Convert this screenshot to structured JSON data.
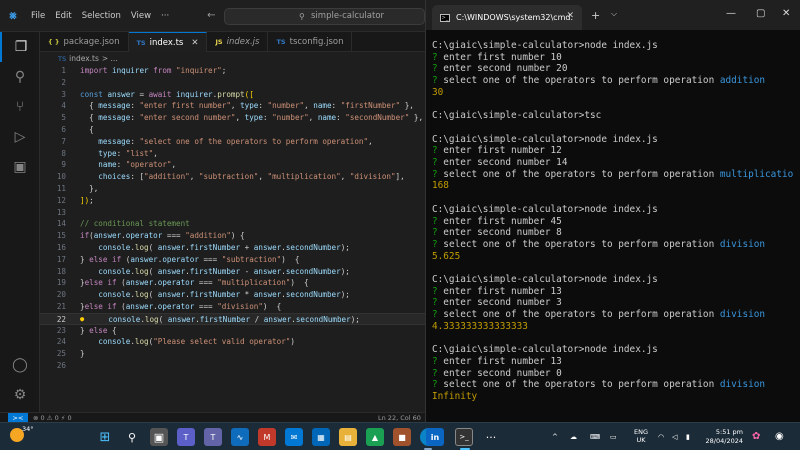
{
  "vscode": {
    "menu": [
      "File",
      "Edit",
      "Selection",
      "View",
      "···"
    ],
    "search_text": "simple-calculator",
    "tabs": [
      {
        "icon": "{ }",
        "type": "json",
        "label": "package.json"
      },
      {
        "icon": "TS",
        "type": "ts",
        "label": "index.ts"
      },
      {
        "icon": "JS",
        "type": "js",
        "label": "index.js"
      },
      {
        "icon": "TS",
        "type": "ts",
        "label": "tsconfig.json"
      }
    ],
    "breadcrumb": {
      "icon": "TS",
      "label": "index.ts",
      "more": "> ..."
    },
    "lines": [
      {
        "n": "1",
        "tokens": [
          [
            "kw",
            "import "
          ],
          [
            "vr",
            "inquirer "
          ],
          [
            "kw",
            "from "
          ],
          [
            "st",
            "\"inquirer\""
          ],
          [
            "",
            "; "
          ]
        ]
      },
      {
        "n": "2",
        "tokens": []
      },
      {
        "n": "3",
        "tokens": [
          [
            "bl",
            "const "
          ],
          [
            "vr",
            "answer"
          ],
          [
            "",
            " = "
          ],
          [
            "kw",
            "await "
          ],
          [
            "vr",
            "inquirer"
          ],
          [
            "",
            "."
          ],
          [
            "fn",
            "prompt"
          ],
          [
            "pu",
            "(["
          ]
        ]
      },
      {
        "n": "4",
        "tokens": [
          [
            "",
            "  { "
          ],
          [
            "vr",
            "message"
          ],
          [
            "",
            ": "
          ],
          [
            "st",
            "\"enter first number\""
          ],
          [
            "",
            ", "
          ],
          [
            "vr",
            "type"
          ],
          [
            "",
            ": "
          ],
          [
            "st",
            "\"number\""
          ],
          [
            "",
            ", "
          ],
          [
            "vr",
            "name"
          ],
          [
            "",
            ": "
          ],
          [
            "st",
            "\"firstNumber\""
          ],
          [
            "",
            " },"
          ]
        ]
      },
      {
        "n": "5",
        "tokens": [
          [
            "",
            "  { "
          ],
          [
            "vr",
            "message"
          ],
          [
            "",
            ": "
          ],
          [
            "st",
            "\"enter second number\""
          ],
          [
            "",
            ", "
          ],
          [
            "vr",
            "type"
          ],
          [
            "",
            ": "
          ],
          [
            "st",
            "\"number\""
          ],
          [
            "",
            ", "
          ],
          [
            "vr",
            "name"
          ],
          [
            "",
            ": "
          ],
          [
            "st",
            "\"secondNumber\""
          ],
          [
            "",
            " },"
          ]
        ]
      },
      {
        "n": "6",
        "tokens": [
          [
            "",
            "  {"
          ]
        ]
      },
      {
        "n": "7",
        "tokens": [
          [
            "",
            "    "
          ],
          [
            "vr",
            "message"
          ],
          [
            "",
            ": "
          ],
          [
            "st",
            "\"select one of the operators to perform operation\""
          ],
          [
            "",
            ","
          ]
        ]
      },
      {
        "n": "8",
        "tokens": [
          [
            "",
            "    "
          ],
          [
            "vr",
            "type"
          ],
          [
            "",
            ": "
          ],
          [
            "st",
            "\"list\""
          ],
          [
            "",
            ","
          ]
        ]
      },
      {
        "n": "9",
        "tokens": [
          [
            "",
            "    "
          ],
          [
            "vr",
            "name"
          ],
          [
            "",
            ": "
          ],
          [
            "st",
            "\"operator\""
          ],
          [
            "",
            ","
          ]
        ]
      },
      {
        "n": "10",
        "tokens": [
          [
            "",
            "    "
          ],
          [
            "vr",
            "choices"
          ],
          [
            "",
            ": ["
          ],
          [
            "st",
            "\"addition\""
          ],
          [
            "",
            ", "
          ],
          [
            "st",
            "\"subtraction\""
          ],
          [
            "",
            ", "
          ],
          [
            "st",
            "\"multiplication\""
          ],
          [
            "",
            ", "
          ],
          [
            "st",
            "\"division\""
          ],
          [
            "",
            "],"
          ]
        ]
      },
      {
        "n": "11",
        "tokens": [
          [
            "",
            "  },"
          ]
        ]
      },
      {
        "n": "12",
        "tokens": [
          [
            "pu",
            "])"
          ],
          [
            "",
            ";"
          ]
        ]
      },
      {
        "n": "13",
        "tokens": []
      },
      {
        "n": "14",
        "tokens": [
          [
            "cm",
            "// conditional statement"
          ]
        ]
      },
      {
        "n": "15",
        "tokens": [
          [
            "kw",
            "if"
          ],
          [
            "",
            "("
          ],
          [
            "vr",
            "answer"
          ],
          [
            "",
            "."
          ],
          [
            "vr",
            "operator"
          ],
          [
            "",
            " === "
          ],
          [
            "st",
            "\"addition\""
          ],
          [
            "",
            ") {"
          ]
        ]
      },
      {
        "n": "16",
        "tokens": [
          [
            "",
            "    "
          ],
          [
            "vr",
            "console"
          ],
          [
            "",
            "."
          ],
          [
            "fn",
            "log"
          ],
          [
            "",
            "( "
          ],
          [
            "vr",
            "answer"
          ],
          [
            "",
            "."
          ],
          [
            "vr",
            "firstNumber"
          ],
          [
            "",
            " + "
          ],
          [
            "vr",
            "answer"
          ],
          [
            "",
            "."
          ],
          [
            "vr",
            "secondNumber"
          ],
          [
            "",
            ");"
          ]
        ]
      },
      {
        "n": "17",
        "tokens": [
          [
            "",
            "} "
          ],
          [
            "kw",
            "else if "
          ],
          [
            "",
            "("
          ],
          [
            "vr",
            "answer"
          ],
          [
            "",
            "."
          ],
          [
            "vr",
            "operator"
          ],
          [
            "",
            " === "
          ],
          [
            "st",
            "\"subtraction\""
          ],
          [
            "",
            ")  {"
          ]
        ]
      },
      {
        "n": "18",
        "tokens": [
          [
            "",
            "    "
          ],
          [
            "vr",
            "console"
          ],
          [
            "",
            "."
          ],
          [
            "fn",
            "log"
          ],
          [
            "",
            "( "
          ],
          [
            "vr",
            "answer"
          ],
          [
            "",
            "."
          ],
          [
            "vr",
            "firstNumber"
          ],
          [
            "",
            " - "
          ],
          [
            "vr",
            "answer"
          ],
          [
            "",
            "."
          ],
          [
            "vr",
            "secondNumber"
          ],
          [
            "",
            ");"
          ]
        ]
      },
      {
        "n": "19",
        "tokens": [
          [
            "",
            "}"
          ],
          [
            "kw",
            "else if "
          ],
          [
            "",
            "("
          ],
          [
            "vr",
            "answer"
          ],
          [
            "",
            "."
          ],
          [
            "vr",
            "operator"
          ],
          [
            "",
            " === "
          ],
          [
            "st",
            "\"multiplication\""
          ],
          [
            "",
            ")  {"
          ]
        ]
      },
      {
        "n": "20",
        "tokens": [
          [
            "",
            "    "
          ],
          [
            "vr",
            "console"
          ],
          [
            "",
            "."
          ],
          [
            "fn",
            "log"
          ],
          [
            "",
            "( "
          ],
          [
            "vr",
            "answer"
          ],
          [
            "",
            "."
          ],
          [
            "vr",
            "firstNumber"
          ],
          [
            "",
            " * "
          ],
          [
            "vr",
            "answer"
          ],
          [
            "",
            "."
          ],
          [
            "vr",
            "secondNumber"
          ],
          [
            "",
            ");"
          ]
        ]
      },
      {
        "n": "21",
        "tokens": [
          [
            "",
            "}"
          ],
          [
            "kw",
            "else if "
          ],
          [
            "",
            "("
          ],
          [
            "vr",
            "answer"
          ],
          [
            "",
            "."
          ],
          [
            "vr",
            "operator"
          ],
          [
            "",
            " === "
          ],
          [
            "st",
            "\"division\""
          ],
          [
            "",
            ")  {"
          ]
        ]
      },
      {
        "n": "22",
        "current": true,
        "tokens": [
          [
            "",
            "    "
          ],
          [
            "vr",
            "console"
          ],
          [
            "",
            "."
          ],
          [
            "fn",
            "log"
          ],
          [
            "",
            "( "
          ],
          [
            "vr",
            "answer"
          ],
          [
            "",
            "."
          ],
          [
            "vr",
            "firstNumber"
          ],
          [
            "",
            " / "
          ],
          [
            "vr",
            "answer"
          ],
          [
            "",
            "."
          ],
          [
            "vr",
            "secondNumber"
          ],
          [
            "",
            ");"
          ]
        ]
      },
      {
        "n": "23",
        "tokens": [
          [
            "",
            "} "
          ],
          [
            "kw",
            "else "
          ],
          [
            "",
            "{"
          ]
        ]
      },
      {
        "n": "24",
        "tokens": [
          [
            "",
            "    "
          ],
          [
            "vr",
            "console"
          ],
          [
            "",
            "."
          ],
          [
            "fn",
            "log"
          ],
          [
            "",
            "("
          ],
          [
            "st",
            "\"Please select valid operator\""
          ],
          [
            "",
            ")"
          ]
        ]
      },
      {
        "n": "25",
        "tokens": [
          [
            "",
            "}"
          ]
        ]
      },
      {
        "n": "26",
        "tokens": []
      }
    ],
    "status": {
      "remote": "><",
      "problems": "⊗ 0 ⚠ 0   ⚡ 0",
      "position": "Ln 22, Col 60"
    }
  },
  "terminal": {
    "tab_title": "C:\\WINDOWS\\system32\\cmd.",
    "lines": [
      [
        [
          "",
          ""
        ]
      ],
      [
        [
          "",
          "C:\\giaic\\simple-calculator>node index.js"
        ]
      ],
      [
        [
          "q",
          "? "
        ],
        [
          "",
          "enter first number 10"
        ]
      ],
      [
        [
          "q",
          "? "
        ],
        [
          "",
          "enter second number 20"
        ]
      ],
      [
        [
          "q",
          "? "
        ],
        [
          "",
          "select one of the operators to perform operation "
        ],
        [
          "ans",
          "addition"
        ]
      ],
      [
        [
          "res",
          "30"
        ]
      ],
      [
        [
          "",
          ""
        ]
      ],
      [
        [
          "",
          "C:\\giaic\\simple-calculator>tsc"
        ]
      ],
      [
        [
          "",
          ""
        ]
      ],
      [
        [
          "",
          "C:\\giaic\\simple-calculator>node index.js"
        ]
      ],
      [
        [
          "q",
          "? "
        ],
        [
          "",
          "enter first number 12"
        ]
      ],
      [
        [
          "q",
          "? "
        ],
        [
          "",
          "enter second number 14"
        ]
      ],
      [
        [
          "q",
          "? "
        ],
        [
          "",
          "select one of the operators to perform operation "
        ],
        [
          "ans",
          "multiplicatio"
        ]
      ],
      [
        [
          "res",
          "168"
        ]
      ],
      [
        [
          "",
          ""
        ]
      ],
      [
        [
          "",
          "C:\\giaic\\simple-calculator>node index.js"
        ]
      ],
      [
        [
          "q",
          "? "
        ],
        [
          "",
          "enter first number 45"
        ]
      ],
      [
        [
          "q",
          "? "
        ],
        [
          "",
          "enter second number 8"
        ]
      ],
      [
        [
          "q",
          "? "
        ],
        [
          "",
          "select one of the operators to perform operation "
        ],
        [
          "ans",
          "division"
        ]
      ],
      [
        [
          "res",
          "5.625"
        ]
      ],
      [
        [
          "",
          ""
        ]
      ],
      [
        [
          "",
          "C:\\giaic\\simple-calculator>node index.js"
        ]
      ],
      [
        [
          "q",
          "? "
        ],
        [
          "",
          "enter first number 13"
        ]
      ],
      [
        [
          "q",
          "? "
        ],
        [
          "",
          "enter second number 3"
        ]
      ],
      [
        [
          "q",
          "? "
        ],
        [
          "",
          "select one of the operators to perform operation "
        ],
        [
          "ans",
          "division"
        ]
      ],
      [
        [
          "res",
          "4.333333333333333"
        ]
      ],
      [
        [
          "",
          ""
        ]
      ],
      [
        [
          "",
          "C:\\giaic\\simple-calculator>node index.js"
        ]
      ],
      [
        [
          "q",
          "? "
        ],
        [
          "",
          "enter first number 13"
        ]
      ],
      [
        [
          "q",
          "? "
        ],
        [
          "",
          "enter second number 0"
        ]
      ],
      [
        [
          "q",
          "? "
        ],
        [
          "",
          "select one of the operators to perform operation "
        ],
        [
          "ans",
          "division"
        ]
      ],
      [
        [
          "res",
          "Infinity"
        ]
      ]
    ]
  },
  "taskbar": {
    "temperature": "34°",
    "lang_top": "ENG",
    "lang_bottom": "UK",
    "time": "5:51 pm",
    "date": "28/04/2024",
    "chevron": "^",
    "dots": "···"
  },
  "colors": {
    "accent": "#0078d4",
    "terminal_prompt": "#13a10e",
    "terminal_answer": "#3a96dd",
    "terminal_result": "#c19c00"
  }
}
